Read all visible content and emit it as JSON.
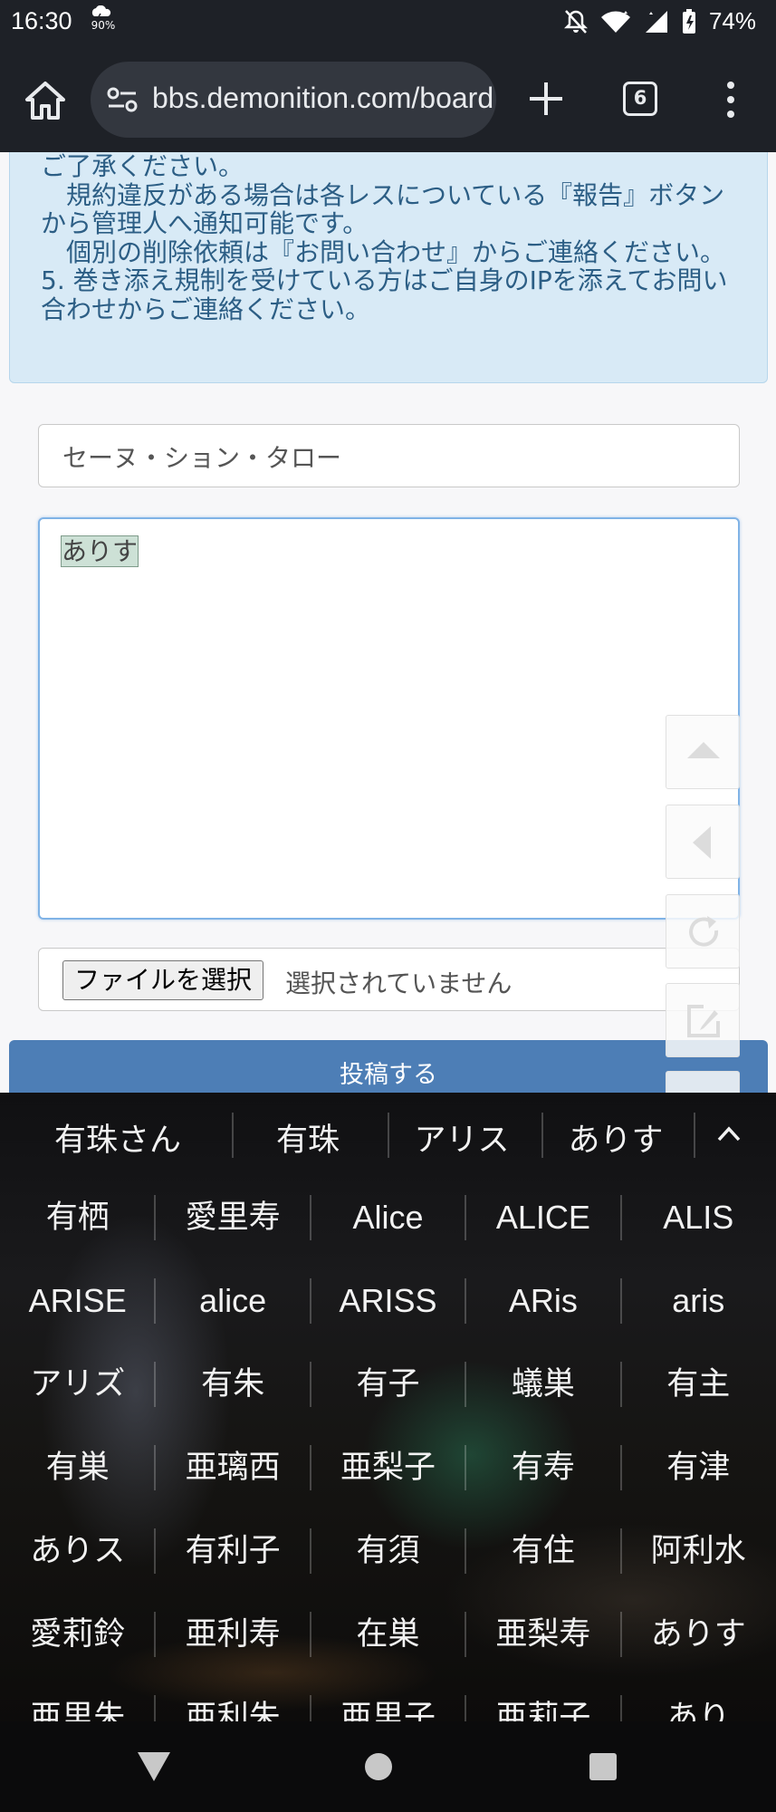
{
  "status_bar": {
    "time": "16:30",
    "small_icon_text": "90%",
    "battery": "74%"
  },
  "browser": {
    "url": "bbs.demonition.com/board",
    "tab_count": "6"
  },
  "notice": {
    "lines": [
      "ご了承ください。",
      "　規約違反がある場合は各レスについている『報告』ボタンから管理人へ通知可能です。",
      "　個別の削除依頼は『お問い合わせ』からご連絡ください。",
      "5. 巻き添え規制を受けている方はご自身のIPを添えてお問い合わせからご連絡ください。"
    ]
  },
  "form": {
    "name_value": "セーヌ・ション・タロー",
    "body_value": "ありす",
    "file_button_label": "ファイルを選択",
    "file_status": "選択されていません",
    "submit_label": "投稿する"
  },
  "keyboard": {
    "suggestions": [
      "有珠さん",
      "有珠",
      "アリス",
      "ありす"
    ],
    "rows": [
      [
        "有栖",
        "愛里寿",
        "Alice",
        "ALICE",
        "ALIS"
      ],
      [
        "ARISE",
        "alice",
        "ARISS",
        "ARis",
        "aris"
      ],
      [
        "アリズ",
        "有朱",
        "有子",
        "蟻巣",
        "有主"
      ],
      [
        "有巣",
        "亜璃西",
        "亜梨子",
        "有寿",
        "有津"
      ],
      [
        "ありス",
        "有利子",
        "有須",
        "有住",
        "阿利水"
      ],
      [
        "愛莉鈴",
        "亜利寿",
        "在巣",
        "亜梨寿",
        "ありす"
      ],
      [
        "亜里朱",
        "亜利朱",
        "亜里子",
        "亜莉子",
        "あり"
      ]
    ]
  },
  "colors": {
    "browser_bar": "#1e2127",
    "notice_bg": "#d8eaf6",
    "notice_text": "#2c5e85",
    "submit_bg": "#4d7eb6"
  }
}
